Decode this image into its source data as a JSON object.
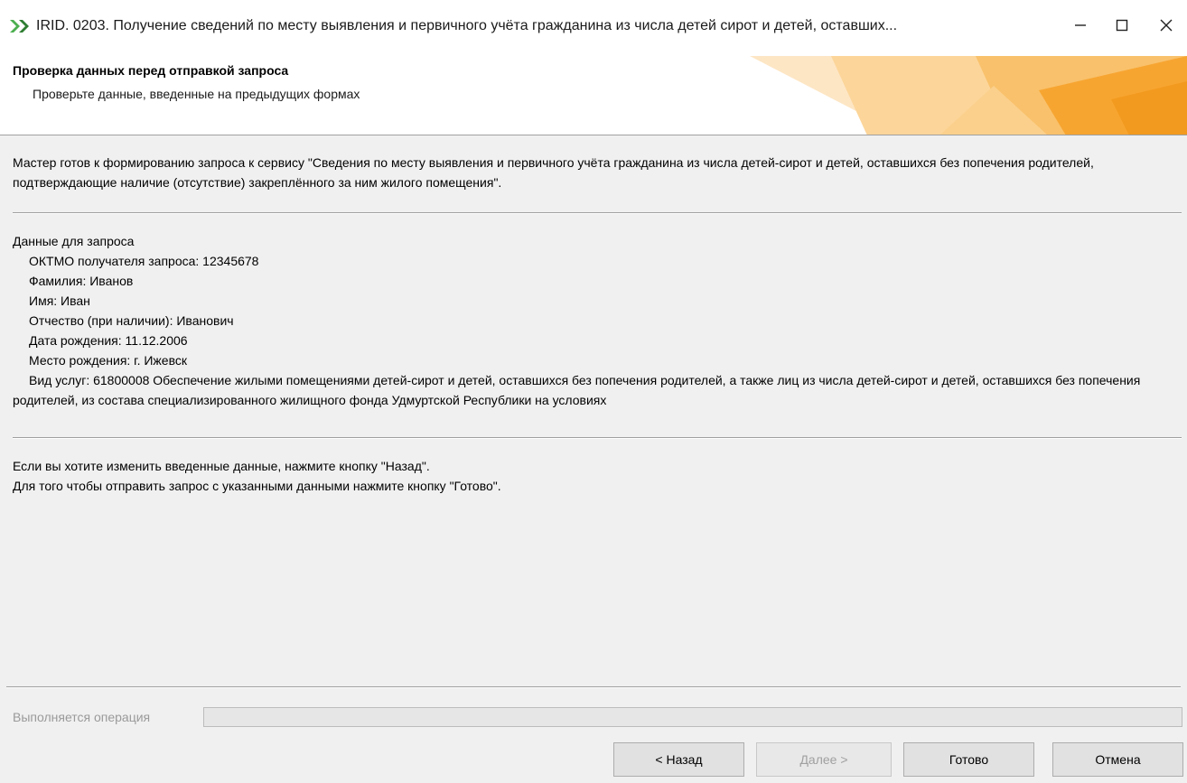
{
  "window": {
    "title": "IRID. 0203. Получение сведений по месту выявления и первичного учёта гражданина из числа детей сирот и детей, оставших...",
    "minimize_icon": "minimize-icon",
    "maximize_icon": "maximize-icon",
    "close_icon": "close-icon"
  },
  "header": {
    "title": "Проверка данных перед отправкой запроса",
    "subtitle": "Проверьте данные, введенные на предыдущих формах",
    "accent_color": "#f7a531"
  },
  "content": {
    "intro": "Мастер готов к формированию запроса к сервису \"Сведения по месту выявления и первичного учёта гражданина из числа детей-сирот и детей, оставшихся без попечения родителей, подтверждающие наличие (отсутствие) закреплённого за ним жилого помещения\".",
    "data_heading": "Данные для запроса",
    "fields": [
      "ОКТМО получателя запроса: 12345678",
      "Фамилия: Иванов",
      "Имя: Иван",
      "Отчество (при наличии): Иванович",
      "Дата рождения: 11.12.2006",
      "Место рождения: г. Ижевск"
    ],
    "service": "Вид услуг: 61800008 Обеспечение жилыми помещениями детей-сирот и детей, оставшихся без попечения родителей, а также лиц из числа детей-сирот и детей, оставшихся без попечения родителей, из состава специализированного жилищного фонда Удмуртской Республики на условиях",
    "outro_line1": "Если вы хотите изменить введенные данные, нажмите кнопку \"Назад\".",
    "outro_line2": "Для того чтобы отправить запрос с указанными данными нажмите кнопку \"Готово\"."
  },
  "status": {
    "operation_label": "Выполняется операция",
    "progress": 0
  },
  "buttons": {
    "back": "< Назад",
    "next": "Далее >",
    "done": "Готово",
    "cancel": "Отмена"
  }
}
